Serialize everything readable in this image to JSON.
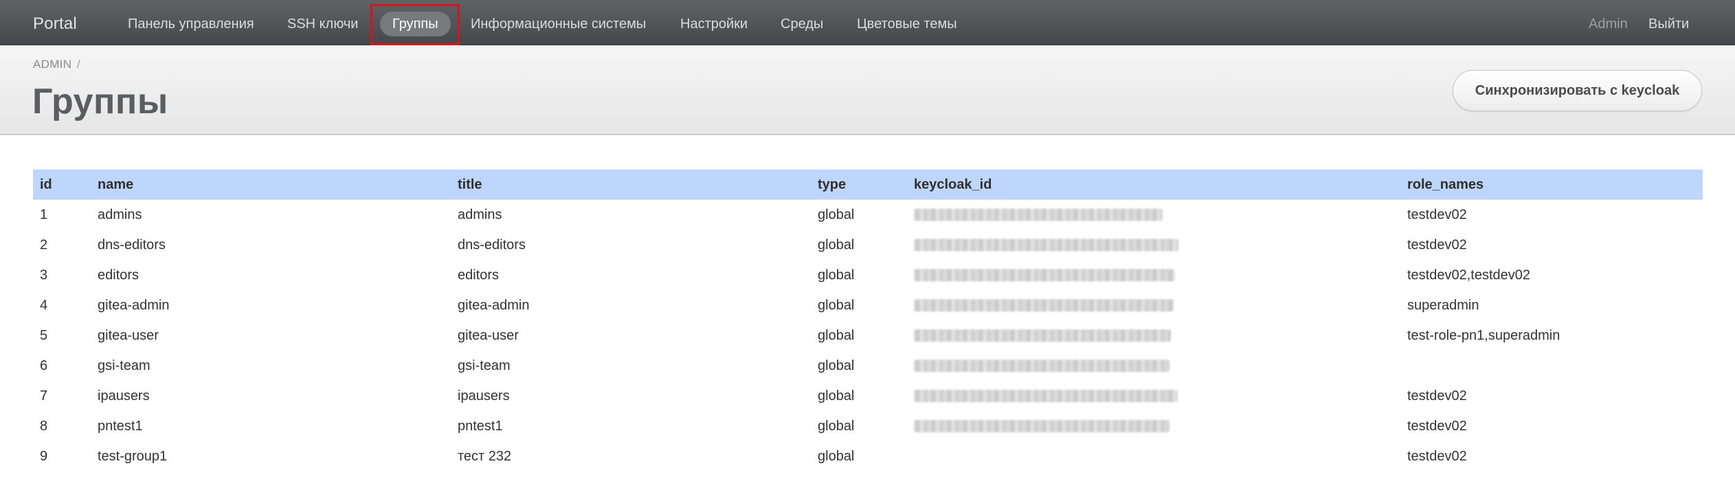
{
  "navbar": {
    "brand": "Portal",
    "items": [
      {
        "label": "Панель управления"
      },
      {
        "label": "SSH ключи"
      },
      {
        "label": "Группы",
        "active": true
      },
      {
        "label": "Информационные системы"
      },
      {
        "label": "Настройки"
      },
      {
        "label": "Среды"
      },
      {
        "label": "Цветовые темы"
      }
    ],
    "user": "Admin",
    "logout": "Выйти"
  },
  "header": {
    "breadcrumb": "ADMIN",
    "breadcrumb_separator": "/",
    "title": "Группы",
    "sync_button": "Синхронизировать с keycloak"
  },
  "table": {
    "columns": [
      "id",
      "name",
      "title",
      "type",
      "keycloak_id",
      "role_names"
    ],
    "rows": [
      {
        "id": "1",
        "name": "admins",
        "title": "admins",
        "type": "global",
        "keycloak_id_redacted": true,
        "role_names": "testdev02"
      },
      {
        "id": "2",
        "name": "dns-editors",
        "title": "dns-editors",
        "type": "global",
        "keycloak_id_redacted": true,
        "role_names": "testdev02"
      },
      {
        "id": "3",
        "name": "editors",
        "title": "editors",
        "type": "global",
        "keycloak_id_redacted": true,
        "role_names": "testdev02,testdev02"
      },
      {
        "id": "4",
        "name": "gitea-admin",
        "title": "gitea-admin",
        "type": "global",
        "keycloak_id_redacted": true,
        "role_names": "superadmin"
      },
      {
        "id": "5",
        "name": "gitea-user",
        "title": "gitea-user",
        "type": "global",
        "keycloak_id_redacted": true,
        "role_names": "test-role-pn1,superadmin"
      },
      {
        "id": "6",
        "name": "gsi-team",
        "title": "gsi-team",
        "type": "global",
        "keycloak_id_redacted": true,
        "role_names": ""
      },
      {
        "id": "7",
        "name": "ipausers",
        "title": "ipausers",
        "type": "global",
        "keycloak_id_redacted": true,
        "role_names": "testdev02"
      },
      {
        "id": "8",
        "name": "pntest1",
        "title": "pntest1",
        "type": "global",
        "keycloak_id_redacted": true,
        "role_names": "testdev02"
      },
      {
        "id": "9",
        "name": "test-group1",
        "title": "тест 232",
        "type": "global",
        "keycloak_id_redacted": false,
        "role_names": "testdev02"
      }
    ]
  },
  "colors": {
    "navbar": "#4e5154",
    "header_bg": "#eeeeee",
    "table_header": "#bed6fb",
    "active_highlight": "#d7141c"
  }
}
